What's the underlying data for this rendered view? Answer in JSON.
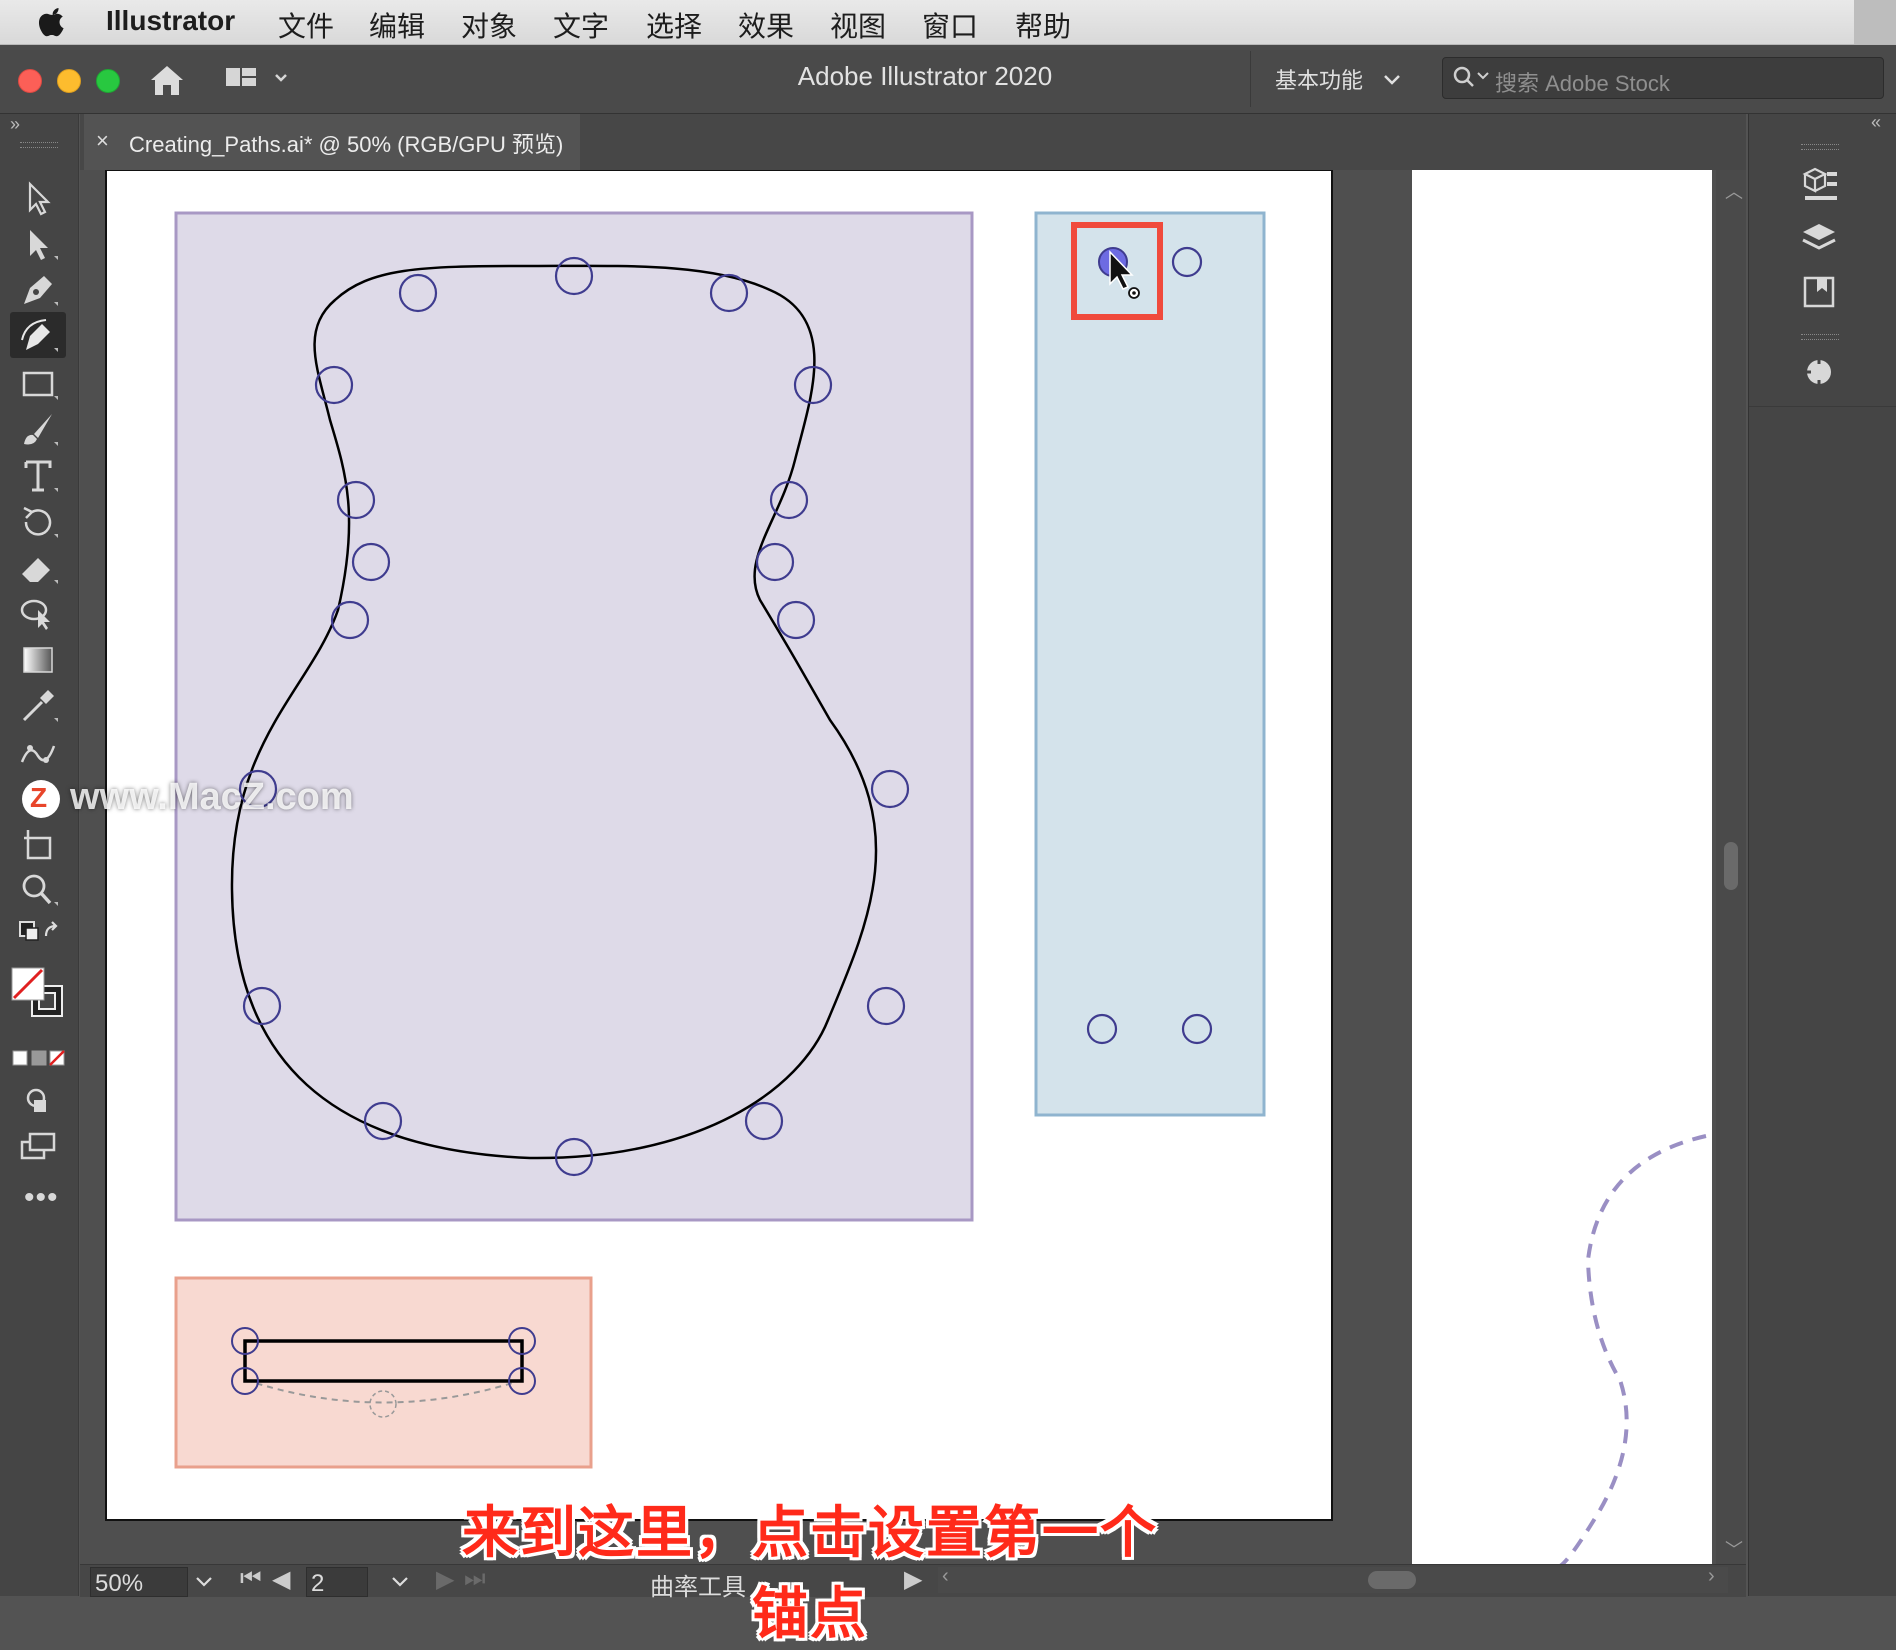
{
  "menubar": {
    "app": "Illustrator",
    "items": [
      "文件",
      "编辑",
      "对象",
      "文字",
      "选择",
      "效果",
      "视图",
      "窗口",
      "帮助"
    ]
  },
  "titlebar": {
    "title": "Adobe Illustrator 2020",
    "workspace": "基本功能",
    "search_placeholder": "搜索 Adobe Stock"
  },
  "document_tab": {
    "close": "×",
    "label": "Creating_Paths.ai* @ 50% (RGB/GPU 预览)"
  },
  "status": {
    "zoom": "50%",
    "artboard": "2",
    "tool": "曲率工具"
  },
  "subtitle": "来到这里，点击设置第一个锚点",
  "watermark": "www.MacZ.com",
  "colors": {
    "purple_box": "#dedae8",
    "purple_border": "#a898c4",
    "blue_box": "#d4e3eb",
    "blue_border": "#8fb4cf",
    "pink_box": "#f8d9d1",
    "pink_border": "#e9a08c",
    "anchor": "#3f3c8f",
    "highlight": "#f04a3c",
    "subtitle": "#ff2a1a"
  },
  "icons": [
    "apple-icon",
    "home-icon",
    "layout-icon",
    "search-icon",
    "selection-tool-icon",
    "direct-selection-icon",
    "pen-tool-icon",
    "curvature-tool-icon",
    "rectangle-tool-icon",
    "paintbrush-icon",
    "type-tool-icon",
    "rotate-tool-icon",
    "eraser-icon",
    "shape-builder-icon",
    "gradient-icon",
    "eyedropper-icon",
    "puppet-warp-icon",
    "artboard-tool-icon",
    "zoom-tool-icon",
    "fill-stroke-icon",
    "more-icon",
    "properties-panel-icon",
    "layers-panel-icon",
    "libraries-panel-icon",
    "cc-panel-icon"
  ]
}
